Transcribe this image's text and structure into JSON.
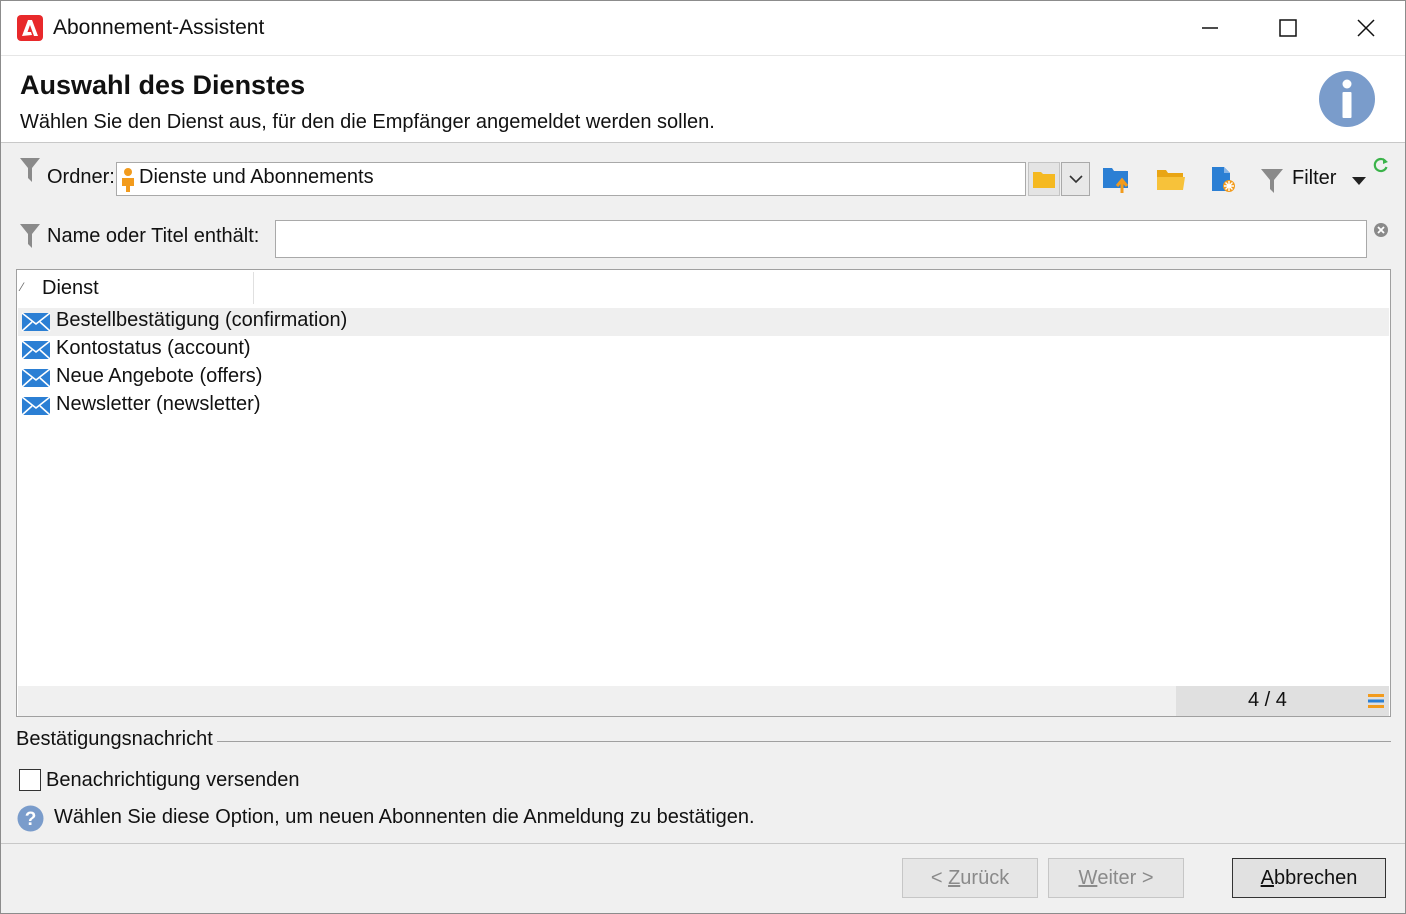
{
  "window": {
    "title": "Abonnement-Assistent",
    "app_icon": "adobe-icon"
  },
  "header": {
    "title": "Auswahl des Dienstes",
    "subtitle": "Wählen Sie den Dienst aus, für den die Empfänger angemeldet werden sollen.",
    "icon": "info-icon"
  },
  "folder": {
    "label": "Ordner:",
    "value": "Dienste und Abonnements"
  },
  "toolbar": {
    "filter_label": "Filter"
  },
  "search": {
    "label": "Name oder Titel enthält:",
    "value": ""
  },
  "list": {
    "column": "Dienst",
    "rows": [
      {
        "label": "Bestellbestätigung (confirmation)",
        "selected": true
      },
      {
        "label": "Kontostatus (account)",
        "selected": false
      },
      {
        "label": "Neue Angebote (offers)",
        "selected": false
      },
      {
        "label": "Newsletter (newsletter)",
        "selected": false
      }
    ],
    "counter": "4 / 4"
  },
  "confirmation": {
    "section_title": "Bestätigungsnachricht",
    "checkbox_label": "Benachrichtigung versenden",
    "checked": false,
    "help_text": "Wählen Sie diese Option, um neuen Abonnenten die Anmeldung zu bestätigen."
  },
  "buttons": {
    "back_prefix": "< ",
    "back_u": "Z",
    "back_rest": "urück",
    "next_u": "W",
    "next_rest": "eiter >",
    "cancel_u": "A",
    "cancel_rest": "bbrechen"
  },
  "colors": {
    "accent_blue": "#1e7fd8",
    "folder_yellow": "#f5b921",
    "adobe_red": "#e8292b"
  }
}
